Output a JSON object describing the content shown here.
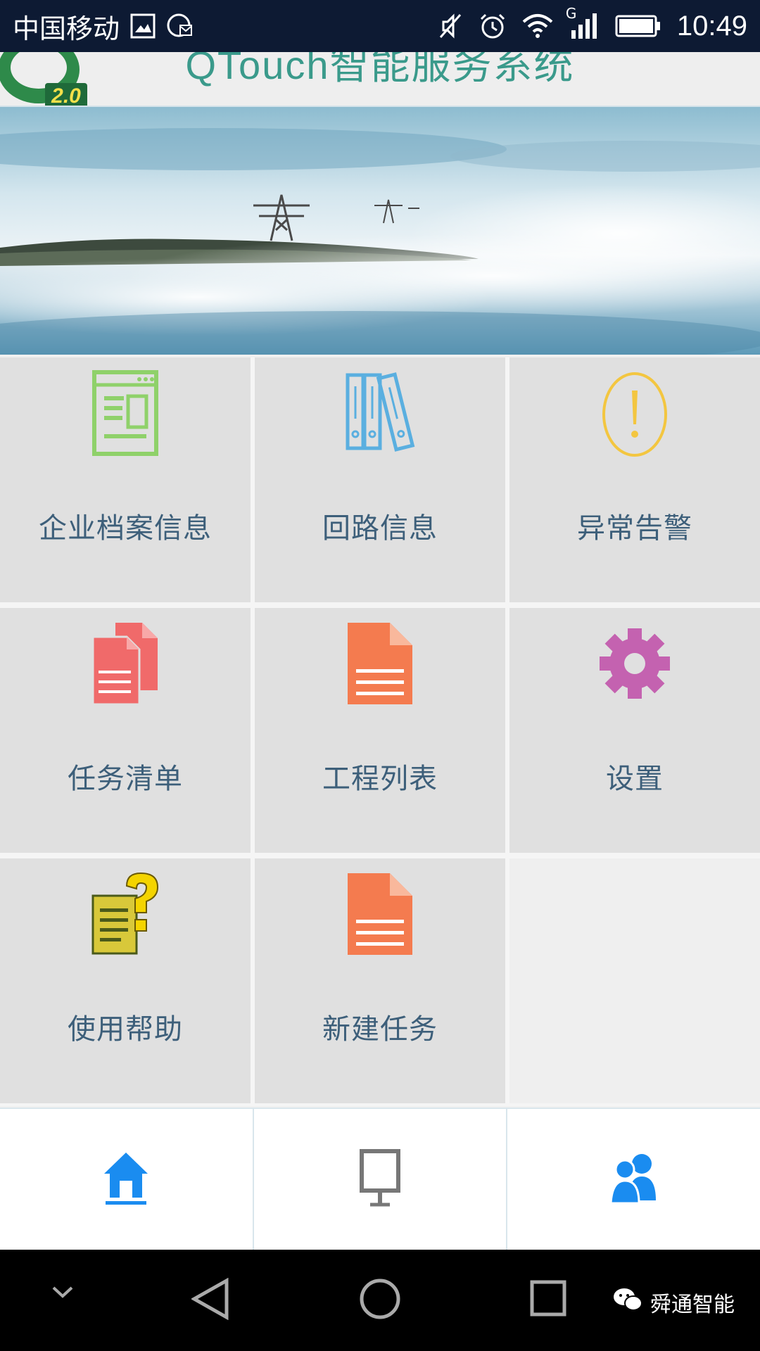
{
  "status_bar": {
    "carrier": "中国移动",
    "network_type": "G",
    "time": "10:49",
    "icons": [
      "image-icon",
      "notification-icon",
      "mute-icon",
      "alarm-icon",
      "wifi-icon",
      "signal-icon",
      "battery-icon"
    ]
  },
  "header": {
    "app_title": "QTouch智能服务系统",
    "logo_version": "2.0"
  },
  "banner": {
    "description_icon": "power-tower-banner"
  },
  "menu": {
    "items": [
      {
        "label": "企业档案信息",
        "icon": "document-form-icon",
        "color": "#8fd16a"
      },
      {
        "label": "回路信息",
        "icon": "binders-icon",
        "color": "#5aafe0"
      },
      {
        "label": "异常告警",
        "icon": "alert-icon",
        "color": "#f3c640"
      },
      {
        "label": "任务清单",
        "icon": "documents-icon",
        "color": "#f06a6a"
      },
      {
        "label": "工程列表",
        "icon": "file-icon",
        "color": "#f47b4f"
      },
      {
        "label": "设置",
        "icon": "gear-icon",
        "color": "#c462b0"
      },
      {
        "label": "使用帮助",
        "icon": "help-document-icon",
        "color": "#e8c423"
      },
      {
        "label": "新建任务",
        "icon": "file-icon",
        "color": "#f47b4f"
      }
    ]
  },
  "tabbar": {
    "tabs": [
      {
        "name": "home",
        "icon": "home-icon",
        "active": true,
        "color": "#1a8cf0"
      },
      {
        "name": "screen",
        "icon": "presentation-icon",
        "active": false,
        "color": "#777777"
      },
      {
        "name": "users",
        "icon": "users-icon",
        "active": false,
        "color": "#1a8cf0"
      }
    ]
  },
  "nav_bar": {
    "watermark": "舜通智能"
  }
}
